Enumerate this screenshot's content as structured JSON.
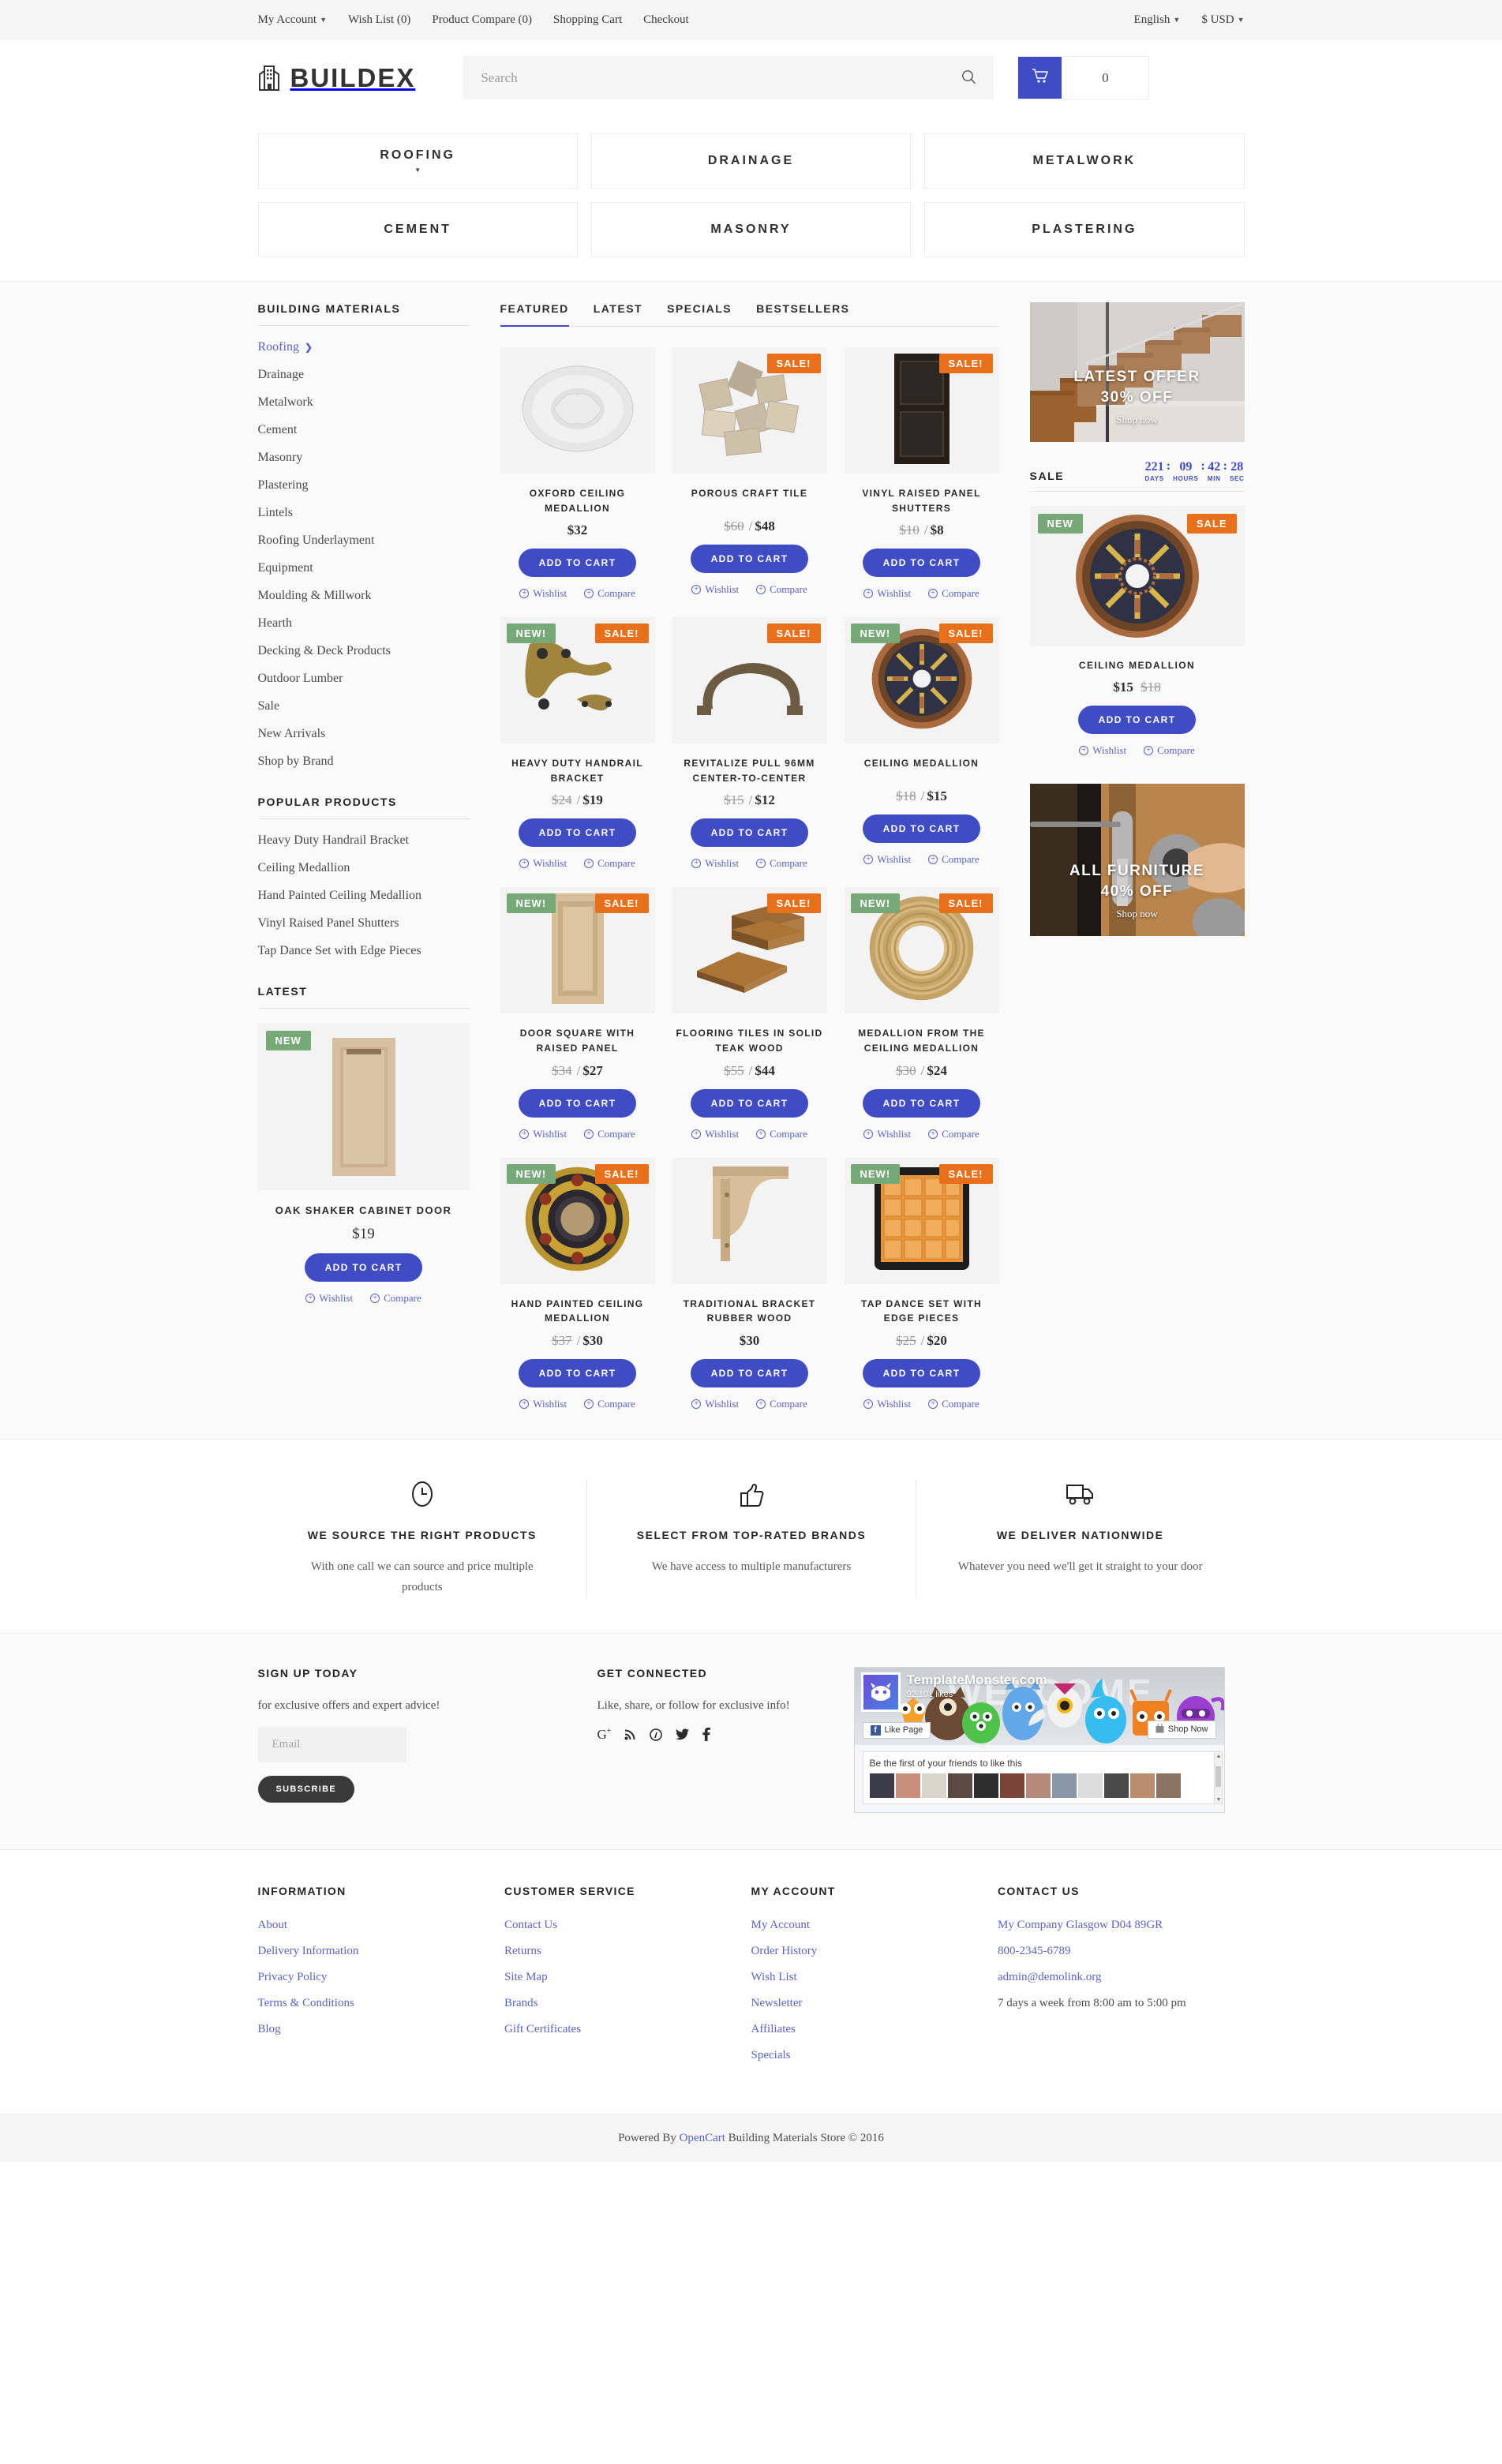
{
  "topbar": {
    "left_links": [
      {
        "label": "My Account",
        "has_caret": true
      },
      {
        "label": "Wish List (0)",
        "has_caret": false
      },
      {
        "label": "Product Compare (0)",
        "has_caret": false
      },
      {
        "label": "Shopping Cart",
        "has_caret": false
      },
      {
        "label": "Checkout",
        "has_caret": false
      }
    ],
    "language": "English",
    "currency": "$ USD"
  },
  "header": {
    "logo_text": "BUILDEX",
    "search_placeholder": "Search",
    "cart_count": "0"
  },
  "categories": [
    {
      "label": "ROOFING",
      "has_dropdown": true
    },
    {
      "label": "DRAINAGE",
      "has_dropdown": false
    },
    {
      "label": "METALWORK",
      "has_dropdown": false
    },
    {
      "label": "CEMENT",
      "has_dropdown": false
    },
    {
      "label": "MASONRY",
      "has_dropdown": false
    },
    {
      "label": "PLASTERING",
      "has_dropdown": false
    }
  ],
  "sidebar": {
    "materials_heading": "BUILDING MATERIALS",
    "materials": [
      {
        "label": "Roofing",
        "active": true,
        "arrow": true
      },
      {
        "label": "Drainage",
        "active": false,
        "arrow": false
      },
      {
        "label": "Metalwork",
        "active": false,
        "arrow": false
      },
      {
        "label": "Cement",
        "active": false,
        "arrow": false
      },
      {
        "label": "Masonry",
        "active": false,
        "arrow": false
      },
      {
        "label": "Plastering",
        "active": false,
        "arrow": false
      },
      {
        "label": "Lintels",
        "active": false,
        "arrow": false
      },
      {
        "label": "Roofing Underlayment",
        "active": false,
        "arrow": false
      },
      {
        "label": "Equipment",
        "active": false,
        "arrow": false
      },
      {
        "label": "Moulding & Millwork",
        "active": false,
        "arrow": false
      },
      {
        "label": "Hearth",
        "active": false,
        "arrow": false
      },
      {
        "label": "Decking & Deck Products",
        "active": false,
        "arrow": false
      },
      {
        "label": "Outdoor Lumber",
        "active": false,
        "arrow": false
      },
      {
        "label": "Sale",
        "active": false,
        "arrow": false
      },
      {
        "label": "New Arrivals",
        "active": false,
        "arrow": false
      },
      {
        "label": "Shop by Brand",
        "active": false,
        "arrow": false
      }
    ],
    "popular_heading": "POPULAR PRODUCTS",
    "popular": [
      "Heavy Duty Handrail Bracket",
      "Ceiling Medallion",
      "Hand Painted Ceiling Medallion",
      "Vinyl Raised Panel Shutters",
      "Tap Dance Set with Edge Pieces"
    ],
    "latest_heading": "LATEST",
    "latest_product": {
      "badge": "NEW",
      "name": "OAK SHAKER CABINET DOOR",
      "price": "$19",
      "cart_label": "ADD TO CART",
      "wishlist_label": "Wishlist",
      "compare_label": "Compare"
    }
  },
  "tabs": [
    {
      "label": "FEATURED",
      "active": true
    },
    {
      "label": "LATEST",
      "active": false
    },
    {
      "label": "SPECIALS",
      "active": false
    },
    {
      "label": "BESTSELLERS",
      "active": false
    }
  ],
  "labels": {
    "add_to_cart": "ADD TO CART",
    "wishlist": "Wishlist",
    "compare": "Compare",
    "badge_new": "NEW!",
    "badge_sale": "SALE!"
  },
  "products": [
    {
      "name": "OXFORD CEILING MEDALLION",
      "price": "$32",
      "old_price": "",
      "new_badge": false,
      "sale_badge": false,
      "img": "oxford-ceiling-medallion"
    },
    {
      "name": "POROUS CRAFT TILE",
      "price": "$48",
      "old_price": "$60",
      "new_badge": false,
      "sale_badge": true,
      "img": "porous-craft-tile"
    },
    {
      "name": "VINYL RAISED PANEL SHUTTERS",
      "price": "$8",
      "old_price": "$10",
      "new_badge": false,
      "sale_badge": true,
      "img": "vinyl-raised-panel-shutters"
    },
    {
      "name": "HEAVY DUTY HANDRAIL BRACKET",
      "price": "$19",
      "old_price": "$24",
      "new_badge": true,
      "sale_badge": true,
      "img": "heavy-duty-handrail-bracket"
    },
    {
      "name": "REVITALIZE PULL 96MM CENTER-TO-CENTER",
      "price": "$12",
      "old_price": "$15",
      "new_badge": false,
      "sale_badge": true,
      "img": "revitalize-pull"
    },
    {
      "name": "CEILING MEDALLION",
      "price": "$15",
      "old_price": "$18",
      "new_badge": true,
      "sale_badge": true,
      "img": "ceiling-medallion"
    },
    {
      "name": "DOOR SQUARE WITH RAISED PANEL",
      "price": "$27",
      "old_price": "$34",
      "new_badge": true,
      "sale_badge": true,
      "img": "door-square-raised-panel"
    },
    {
      "name": "FLOORING TILES IN SOLID TEAK WOOD",
      "price": "$44",
      "old_price": "$55",
      "new_badge": false,
      "sale_badge": true,
      "img": "flooring-tiles-teak"
    },
    {
      "name": "MEDALLION FROM THE CEILING MEDALLION",
      "price": "$24",
      "old_price": "$30",
      "new_badge": true,
      "sale_badge": true,
      "img": "medallion-ceiling"
    },
    {
      "name": "HAND PAINTED CEILING MEDALLION",
      "price": "$30",
      "old_price": "$37",
      "new_badge": true,
      "sale_badge": true,
      "img": "hand-painted-medallion"
    },
    {
      "name": "TRADITIONAL BRACKET RUBBER WOOD",
      "price": "$30",
      "old_price": "",
      "new_badge": false,
      "sale_badge": false,
      "img": "traditional-bracket"
    },
    {
      "name": "TAP DANCE SET WITH EDGE PIECES",
      "price": "$20",
      "old_price": "$25",
      "new_badge": true,
      "sale_badge": true,
      "img": "tap-dance-set"
    }
  ],
  "right": {
    "banner_top": {
      "line1": "LATEST OFFER",
      "line2": "30% OFF",
      "cta": "Shop now"
    },
    "sale_heading": "SALE",
    "countdown": {
      "days": "221",
      "hours": "09",
      "min": "42",
      "sec": "28",
      "days_label": "DAYS",
      "hours_label": "HOURS",
      "min_label": "MIN",
      "sec_label": "SEC"
    },
    "sale_product": {
      "badge_new": "NEW",
      "badge_sale": "SALE",
      "name": "CEILING MEDALLION",
      "price": "$15",
      "old_price": "$18",
      "cart_label": "ADD TO CART",
      "wishlist_label": "Wishlist",
      "compare_label": "Compare"
    },
    "banner_bottom": {
      "line1": "ALL FURNITURE",
      "line2": "40% OFF",
      "cta": "Shop now"
    }
  },
  "services": [
    {
      "icon": "clock-icon",
      "title": "WE SOURCE THE RIGHT PRODUCTS",
      "desc": "With one call we can source and price multiple products"
    },
    {
      "icon": "thumbs-up-icon",
      "title": "SELECT FROM TOP-RATED BRANDS",
      "desc": "We have access to multiple manufacturers"
    },
    {
      "icon": "truck-icon",
      "title": "WE DELIVER NATIONWIDE",
      "desc": "Whatever you need we'll get it straight to your door"
    }
  ],
  "newsletter": {
    "heading": "SIGN UP TODAY",
    "subtext": "for exclusive offers and expert advice!",
    "email_placeholder": "Email",
    "subscribe_label": "SUBSCRIBE"
  },
  "social": {
    "heading": "GET CONNECTED",
    "subtext": "Like, share, or follow for exclusive info!",
    "icons": [
      "google-plus-icon",
      "rss-icon",
      "pinterest-icon",
      "twitter-icon",
      "facebook-icon"
    ]
  },
  "fb_widget": {
    "page_name": "TemplateMonster.com",
    "likes": "92,101 likes",
    "cover_word": "WELCOME",
    "like_button": "Like Page",
    "shop_button": "Shop Now",
    "friends_text": "Be the first of your friends to like this"
  },
  "footer": {
    "columns": [
      {
        "heading": "INFORMATION",
        "links": [
          "About",
          "Delivery Information",
          "Privacy Policy",
          "Terms & Conditions",
          "Blog"
        ]
      },
      {
        "heading": "CUSTOMER SERVICE",
        "links": [
          "Contact Us",
          "Returns",
          "Site Map",
          "Brands",
          "Gift Certificates"
        ]
      },
      {
        "heading": "MY ACCOUNT",
        "links": [
          "My Account",
          "Order History",
          "Wish List",
          "Newsletter",
          "Affiliates",
          "Specials"
        ]
      }
    ],
    "contact": {
      "heading": "CONTACT US",
      "address": "My Company Glasgow D04 89GR",
      "phone": "800-2345-6789",
      "email": "admin@demolink.org",
      "hours": "7 days a week from 8:00 am to 5:00 pm"
    }
  },
  "copyright": {
    "prefix": "Powered By ",
    "link": "OpenCart",
    "suffix": " Building Materials Store © 2016"
  },
  "colors": {
    "accent": "#3f4cc4",
    "link": "#5a63c9",
    "sale": "#e8701a",
    "new": "#76a878"
  }
}
